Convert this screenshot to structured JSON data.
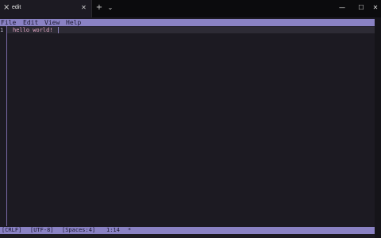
{
  "window": {
    "tab_title": "edit",
    "tab_icon": "terminal-icon",
    "close_icon": "close-icon",
    "new_tab_icon": "plus-icon",
    "dropdown_icon": "chevron-down-icon",
    "minimize_glyph": "—",
    "maximize_glyph": "☐",
    "close_glyph": "✕",
    "tab_close_glyph": "✕",
    "new_tab_glyph": "+",
    "dropdown_glyph": "⌄",
    "tab_icon_glyph": "⨯"
  },
  "menu": {
    "file": "File",
    "edit": "Edit",
    "view": "View",
    "help": "Help"
  },
  "editor": {
    "lines": [
      {
        "number": "1",
        "text": "hello world!"
      }
    ]
  },
  "status": {
    "line_endings": "[CRLF]",
    "encoding": "[UTF-8]",
    "indentation": "[Spaces:4]",
    "cursor_position": "1:14",
    "modified_marker": "*"
  },
  "colors": {
    "accent_bar": "#8a82c4",
    "editor_background": "#1c1a22",
    "text": "#e3a6c4",
    "titlebar": "#0b0b0d"
  }
}
